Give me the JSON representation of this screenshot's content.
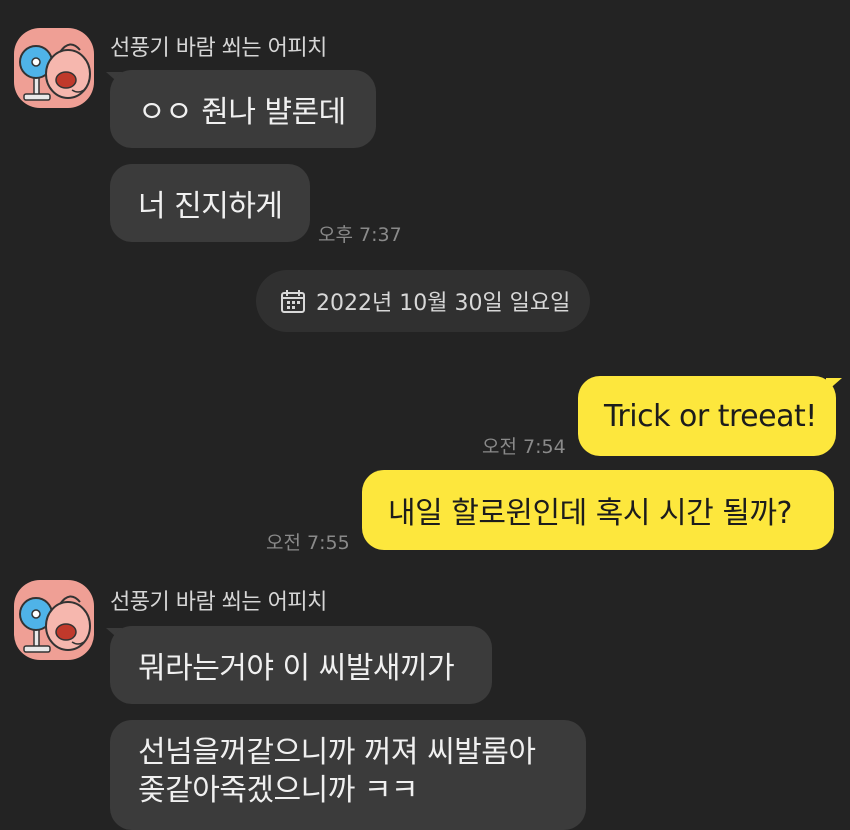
{
  "chat": {
    "group1": {
      "sender": "선풍기 바람 쐬는 어피치",
      "messages": [
        {
          "text": "ㅇㅇ 줜나 뱔론데"
        },
        {
          "text": "너 진지하게",
          "time": "오후 7:37"
        }
      ]
    },
    "date_separator": {
      "icon": "calendar-icon",
      "text": "2022년 10월 30일 일요일"
    },
    "outgoing": [
      {
        "text": "Trick or treeat!",
        "time": "오전 7:54"
      },
      {
        "text": "내일 할로윈인데 혹시 시간 될까?",
        "time": "오전 7:55"
      }
    ],
    "group2": {
      "sender": "선풍기 바람 쐬는 어피치",
      "messages": [
        {
          "text": "뭐라는거야 이 씨발새끼가"
        },
        {
          "line1": "선넘을꺼같으니까 꺼져 씨발롬아",
          "line2": "좆같아죽겠으니까 ㅋㅋ"
        }
      ]
    }
  },
  "colors": {
    "background": "#232323",
    "incoming_bubble": "#3b3b3b",
    "outgoing_bubble": "#fde73d",
    "avatar_bg": "#ef9f95"
  }
}
